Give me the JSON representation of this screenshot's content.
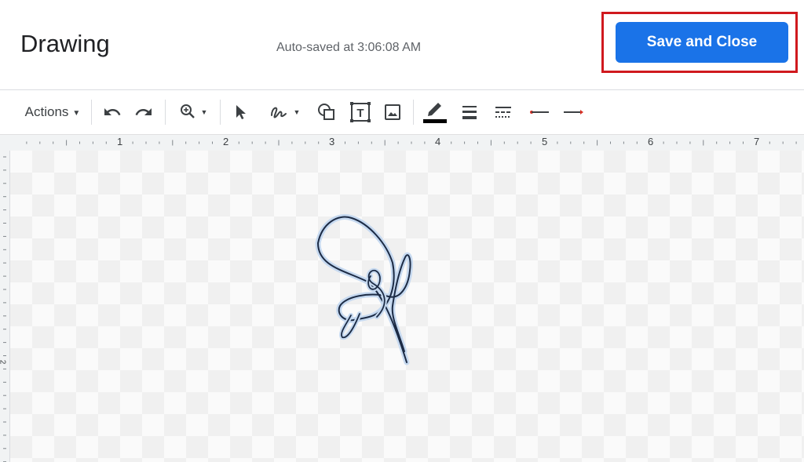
{
  "header": {
    "title": "Drawing",
    "autosave_text": "Auto-saved at 3:06:08 AM",
    "save_label": "Save and Close",
    "accent_color": "#1a73e8",
    "highlight_color": "#d0191e"
  },
  "toolbar": {
    "actions_label": "Actions",
    "icons": [
      "undo-icon",
      "redo-icon",
      "zoom-icon",
      "select-icon",
      "scribble-icon",
      "shape-icon",
      "text-box-icon",
      "image-icon",
      "pen-color-icon",
      "line-weight-icon",
      "line-dash-icon",
      "line-start-icon",
      "line-end-icon"
    ]
  },
  "ruler": {
    "numbers": [
      "1",
      "2",
      "3",
      "4",
      "5",
      "6",
      "7"
    ],
    "side_number": "2"
  }
}
